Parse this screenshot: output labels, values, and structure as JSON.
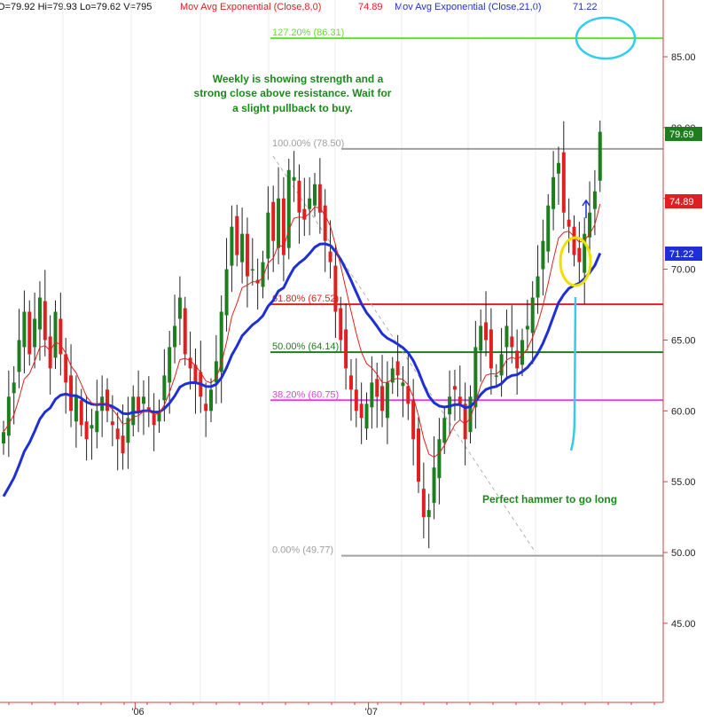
{
  "header": {
    "ohlc_text": "O=79.92  Hi=79.93  Lo=79.62  V=795",
    "ma1_label": "Mov Avg Exponential (Close,8,0)",
    "ma1_value": "74.89",
    "ma2_label": "Mov Avg Exponential (Close,21,0)",
    "ma2_value": "71.22"
  },
  "annotations": {
    "note_line1": "Weekly is showing strength and a",
    "note_line2": "strong close above resistance. Wait for",
    "note_line3": "a slight pullback to buy.",
    "hammer_note": "Perfect hammer to go long"
  },
  "badges": {
    "last_price": "79.69",
    "ma8_value": "74.89",
    "ma21_value": "71.22"
  },
  "colors": {
    "up_candle": "#1e7d1e",
    "down_candle": "#e02020",
    "ma8": "#e02020",
    "ma21": "#1f2fd6",
    "axis": "#d04040",
    "fib_127": "#66dd33",
    "fib_100": "#a0a0a0",
    "fib_618": "#e02020",
    "fib_50": "#1e7d1e",
    "fib_382": "#e040e0",
    "fib_0": "#a0a0a0",
    "cyan_markup": "#33ccee",
    "yellow_markup": "#f0e000"
  },
  "chart_data": {
    "type": "candlestick",
    "frequency": "weekly",
    "ylim": [
      40.5,
      90
    ],
    "y_ticks": [
      45,
      50,
      55,
      60,
      65,
      70,
      75,
      80,
      85
    ],
    "y_tick_labels": [
      "45.00",
      "50.00",
      "55.00",
      "60.00",
      "65.00",
      "70.00",
      "75.00",
      "80.00",
      "85.00"
    ],
    "x_tick_labels": [
      "'06",
      "'07"
    ],
    "x_tick_index": [
      31,
      76
    ],
    "fib_levels": [
      {
        "label": "127.20% (86.31)",
        "value": 86.31
      },
      {
        "label": "100.00% (78.50)",
        "value": 78.5
      },
      {
        "label": "61.80% (67.52)",
        "value": 67.52
      },
      {
        "label": "50.00% (64.14)",
        "value": 64.14
      },
      {
        "label": "38.20% (60.75)",
        "value": 60.75
      },
      {
        "label": "0.00% (49.77)",
        "value": 49.77
      }
    ],
    "close": [
      58.5,
      61,
      62,
      65,
      67,
      64,
      66.5,
      68,
      65,
      63,
      67,
      64,
      62,
      60,
      61,
      59,
      58,
      59,
      60,
      61,
      60,
      59,
      58,
      57,
      59.5,
      61,
      60,
      61,
      60,
      59,
      60,
      62.5,
      64.5,
      66,
      68,
      64,
      63,
      62,
      61,
      60,
      61.5,
      63.5,
      67,
      70,
      73,
      71,
      72.5,
      69.5,
      70,
      69,
      70.5,
      74,
      72,
      75,
      71,
      77,
      76.5,
      74,
      73.5,
      75,
      76,
      74,
      72,
      70.5,
      67,
      65,
      63,
      61.5,
      60,
      59.5,
      60.5,
      62,
      61,
      60,
      62,
      63,
      62.5,
      62,
      60.5,
      58,
      55,
      52.5,
      53,
      56,
      58,
      59.5,
      61,
      61.5,
      60.5,
      58,
      61,
      64.5,
      66,
      65,
      63,
      62.5,
      64,
      66,
      64.5,
      63,
      65,
      66,
      68,
      69.5,
      72,
      74.5,
      76.5,
      77.5,
      74,
      73,
      71,
      70.5,
      72.5,
      74,
      75.5,
      79.7
    ],
    "ma8_close_8": null,
    "series": [
      {
        "name": "Mov Avg Exponential (Close,8,0)",
        "last": 74.89
      },
      {
        "name": "Mov Avg Exponential (Close,21,0)",
        "last": 71.22
      }
    ],
    "last_close": 79.69
  }
}
